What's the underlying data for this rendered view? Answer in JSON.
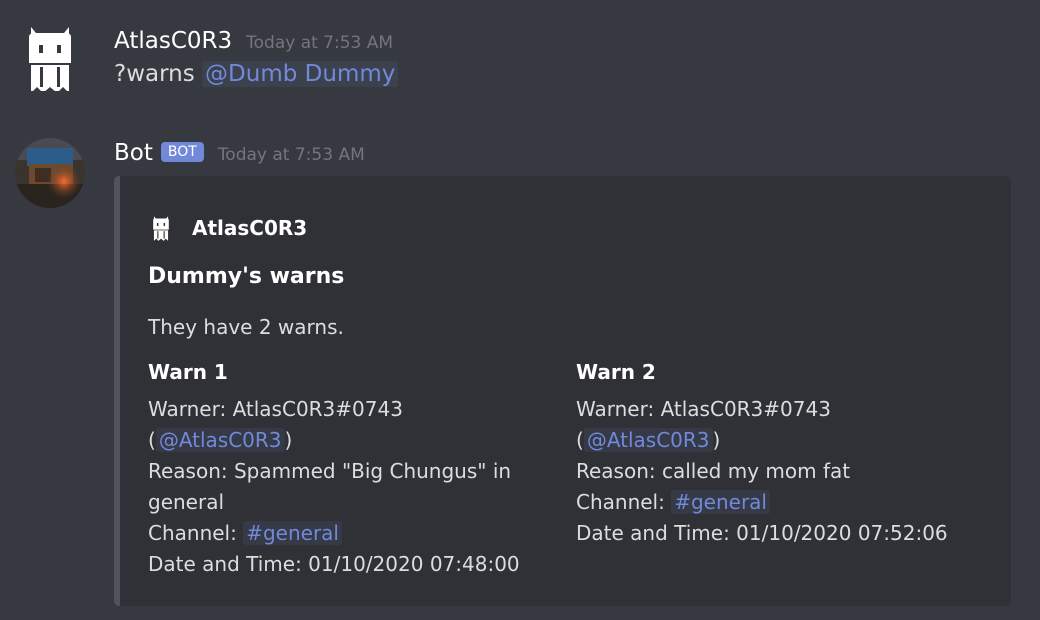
{
  "messages": [
    {
      "username": "AtlasC0R3",
      "timestamp": "Today at 7:53 AM",
      "content_prefix": "?warns ",
      "mention": "@Dumb Dummy"
    },
    {
      "username": "Bot",
      "bot_tag": "BOT",
      "timestamp": "Today at 7:53 AM",
      "embed": {
        "author": "AtlasC0R3",
        "title": "Dummy's warns",
        "description": "They have 2 warns.",
        "fields": [
          {
            "name": "Warn 1",
            "warner_prefix": "Warner: AtlasC0R3#0743",
            "mention_open": "(",
            "mention": "@AtlasC0R3",
            "mention_close": ")",
            "reason_line1": "Reason: Spammed \"Big Chungus\" in",
            "reason_line2": "general",
            "channel_label": "Channel: ",
            "channel": "#general",
            "datetime": "Date and Time: 01/10/2020 07:48:00"
          },
          {
            "name": "Warn 2",
            "warner_prefix": "Warner: AtlasC0R3#0743",
            "mention_open": "(",
            "mention": "@AtlasC0R3",
            "mention_close": ")",
            "reason_line1": "Reason: called my mom fat",
            "channel_label": "Channel: ",
            "channel": "#general",
            "datetime": "Date and Time: 01/10/2020 07:52:06"
          }
        ]
      }
    }
  ],
  "icons": {
    "user_avatar": "robot-ghost-avatar-icon",
    "bot_avatar": "bot-avatar-image",
    "embed_author_icon": "robot-ghost-avatar-icon"
  },
  "colors": {
    "background": "#36393f",
    "embed_background": "#2f3136",
    "embed_border": "#4f545c",
    "mention": "#7289da",
    "bot_tag": "#7289da",
    "timestamp": "#72767d",
    "text": "#dcddde"
  }
}
